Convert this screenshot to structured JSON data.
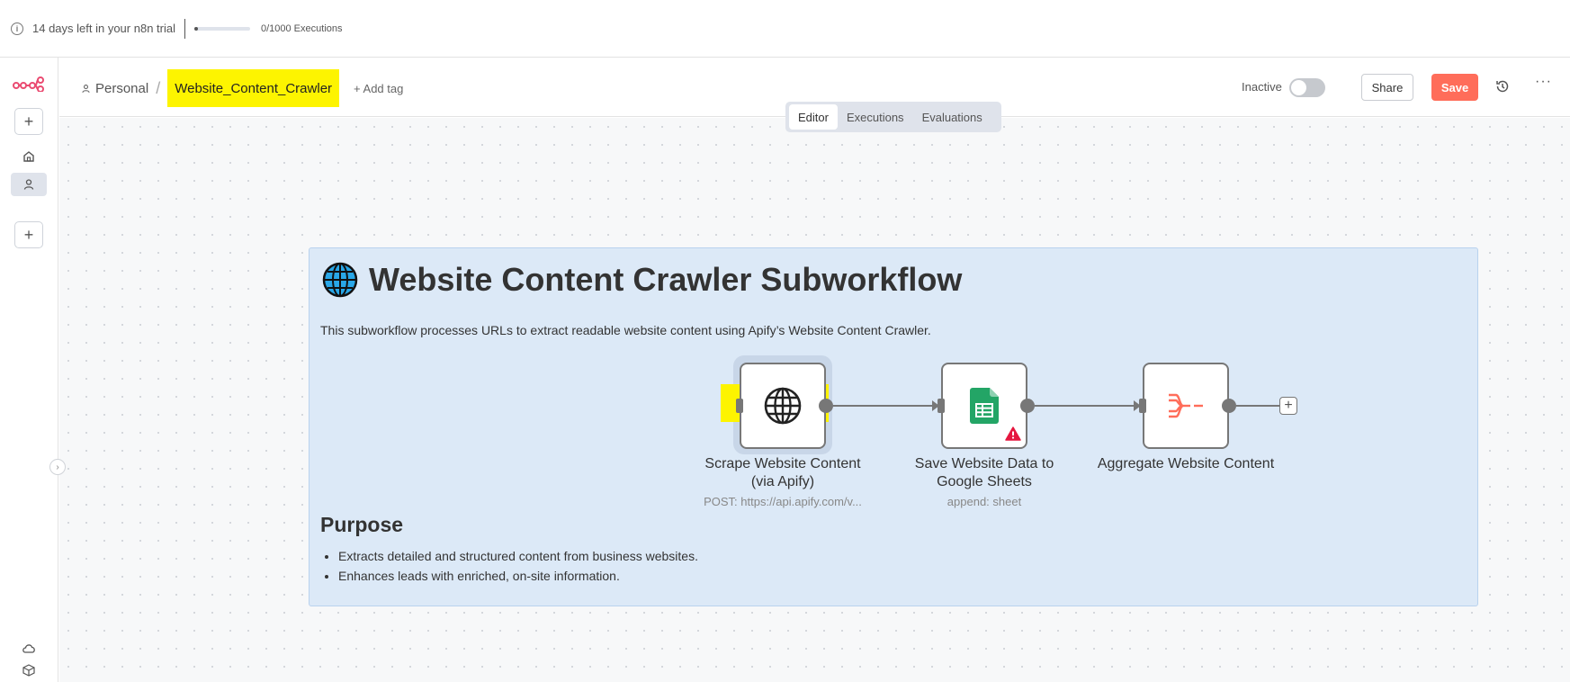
{
  "trial": {
    "text": "14 days left in your n8n trial",
    "executions": "0/1000 Executions",
    "progress_fraction": 0.0
  },
  "header": {
    "project": "Personal",
    "workflow_name": "Website_Content_Crawler",
    "add_tag": "+ Add tag",
    "status_label": "Inactive",
    "share_label": "Share",
    "save_label": "Save"
  },
  "tabs": [
    {
      "label": "Editor",
      "active": true
    },
    {
      "label": "Executions",
      "active": false
    },
    {
      "label": "Evaluations",
      "active": false
    }
  ],
  "note": {
    "title": "Website Content Crawler Subworkflow",
    "description": "This subworkflow processes URLs to extract readable website content using Apify’s Website Content Crawler.",
    "purpose_heading": "Purpose",
    "purpose_items": [
      "Extracts detailed and structured content from business websites.",
      "Enhances leads with enriched, on-site information."
    ]
  },
  "nodes": [
    {
      "label": "Scrape Website Content (via Apify)",
      "subtitle": "POST: https://api.apify.com/v...",
      "icon": "globe-icon"
    },
    {
      "label": "Save Website Data to Google Sheets",
      "subtitle": "append: sheet",
      "icon": "google-sheets-icon",
      "warning": true
    },
    {
      "label": "Aggregate Website Content",
      "subtitle": "",
      "icon": "aggregate-icon"
    }
  ],
  "colors": {
    "accent": "#ff6d5a",
    "highlight": "#fdf400",
    "note_bg": "#dce9f7",
    "sheets_green": "#23a566"
  }
}
